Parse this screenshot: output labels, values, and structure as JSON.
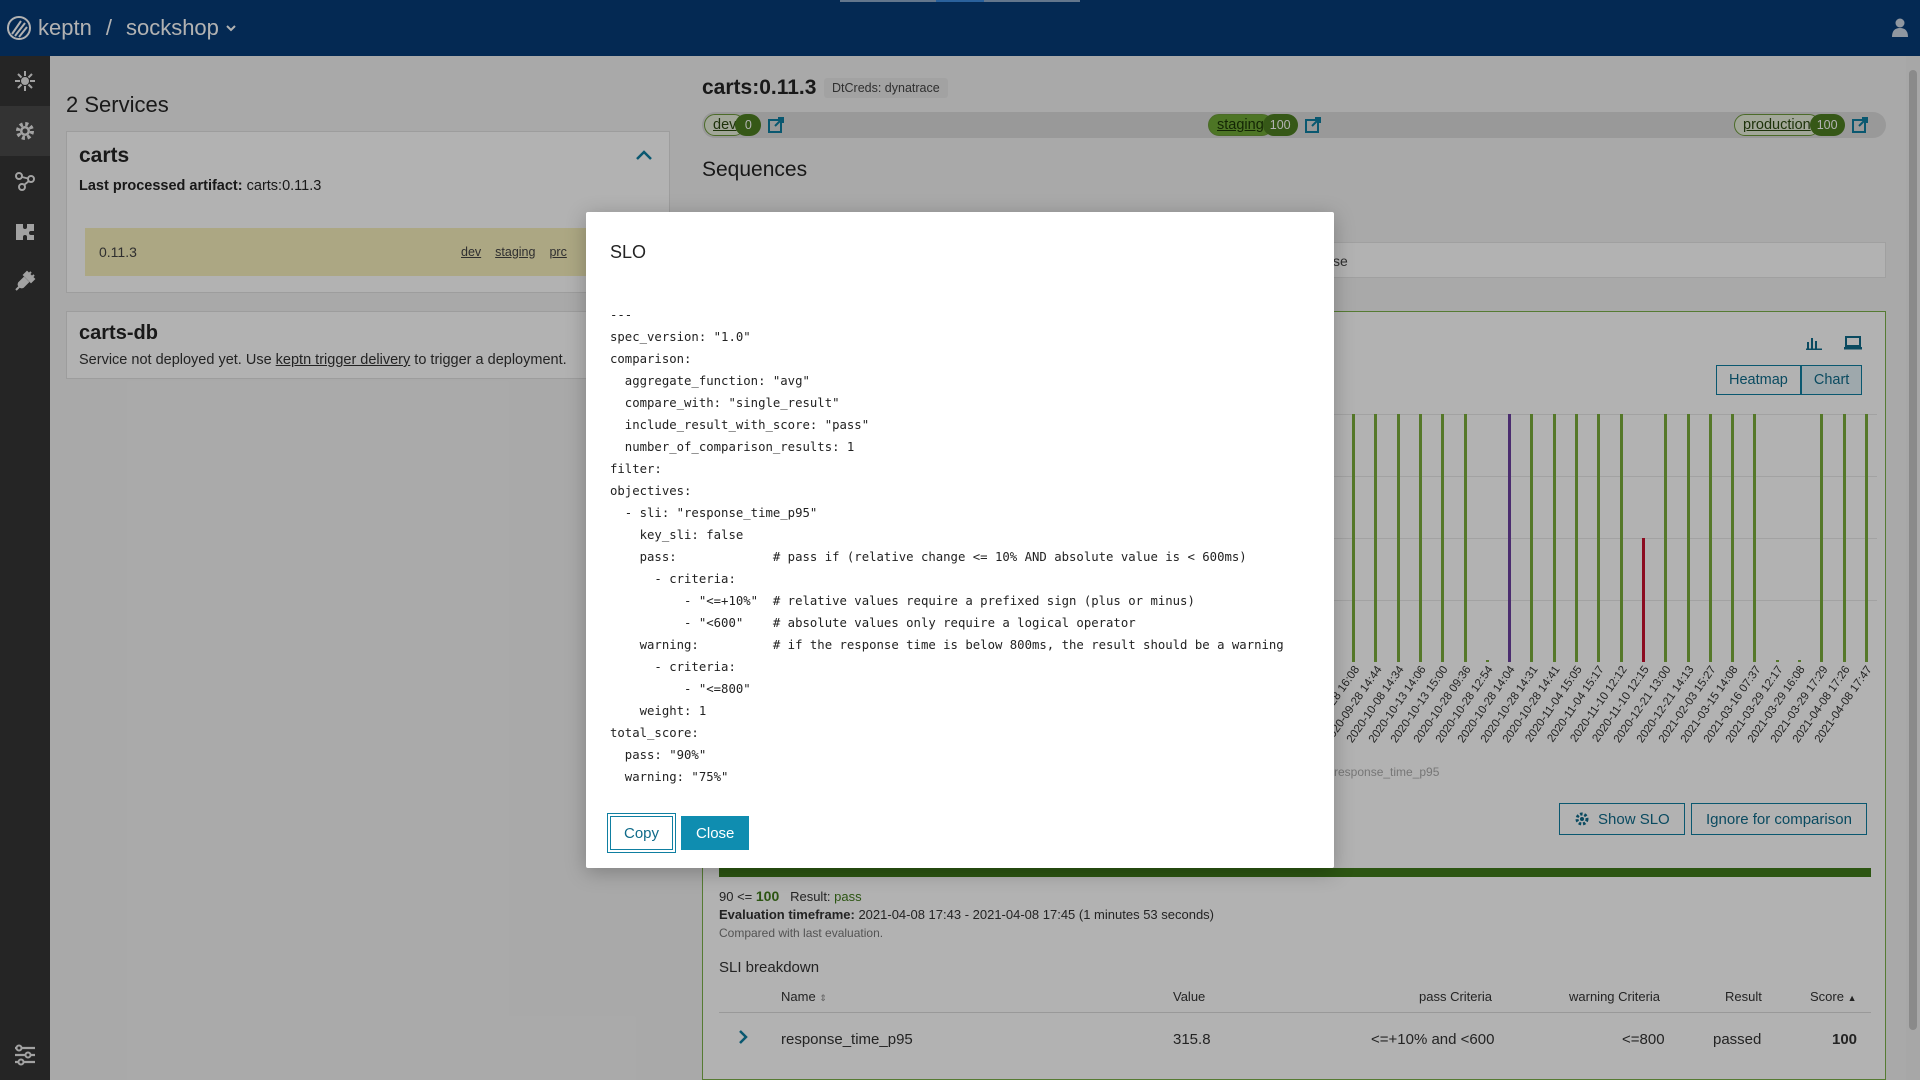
{
  "header": {
    "logo_text": "keptn",
    "separator": "/",
    "project": "sockshop"
  },
  "sidebar": {
    "items": [
      {
        "icon": "hub-icon"
      },
      {
        "icon": "gear-icon"
      },
      {
        "icon": "sequence-icon"
      },
      {
        "icon": "integrations-icon"
      },
      {
        "icon": "plug-icon"
      }
    ],
    "bottom_icon": "settings-sliders-icon"
  },
  "services": {
    "title": "2 Services",
    "carts": {
      "name": "carts",
      "artifact_label": "Last processed artifact:",
      "artifact_value": "carts:0.11.3",
      "row": {
        "version": "0.11.3",
        "stages": [
          "dev",
          "staging",
          "prc"
        ]
      }
    },
    "carts_db": {
      "name": "carts-db",
      "msg_before": "Service not deployed yet. Use ",
      "msg_link": "keptn trigger delivery",
      "msg_after": " to trigger a deployment."
    }
  },
  "detail": {
    "title": "carts:0.11.3",
    "creds": "DtCreds: dynatrace",
    "stages": [
      {
        "name": "dev",
        "count": "0"
      },
      {
        "name": "staging",
        "count": "100"
      },
      {
        "name": "production",
        "count": "100"
      }
    ],
    "sequences_title": "Sequences",
    "sequence_strip_text": "se",
    "toggle": {
      "heatmap": "Heatmap",
      "chart": "Chart"
    },
    "legend_faint": "response_time_p95",
    "show_slo": "Show SLO",
    "ignore": "Ignore for comparison",
    "score": {
      "range": "90 <= ",
      "value": "100",
      "result_label": "Result: ",
      "result": "pass"
    },
    "timeframe": {
      "label": "Evaluation timeframe:",
      "value": " 2021-04-08 17:43 - 2021-04-08 17:45 (1 minutes 53 seconds)"
    },
    "compared": "Compared with last evaluation.",
    "sli": {
      "title": "SLI breakdown",
      "headers": {
        "name": "Name",
        "value": "Value",
        "pass": "pass Criteria",
        "warning": "warning Criteria",
        "result": "Result",
        "score": "Score"
      },
      "row": {
        "name": "response_time_p95",
        "value": "315.8",
        "pass": "<=+10% and  <600",
        "warning": "<=800",
        "result": "passed",
        "score": "100"
      }
    }
  },
  "chart_data": {
    "type": "bar",
    "categories": [
      "..9-28 16:08",
      "2020-09-28 14:44",
      "2020-10-08 14:34",
      "2020-10-13 14:06",
      "2020-10-13 15:00",
      "2020-10-28 09:36",
      "2020-10-28 12:54",
      "2020-10-28 14:04",
      "2020-10-28 14:31",
      "2020-10-28 14:41",
      "2020-11-04 15:05",
      "2020-11-04 15:17",
      "2020-11-10 12:12",
      "2020-11-10 12:15",
      "2020-12-21 13:00",
      "2020-12-21 14:13",
      "2021-02-03 15:27",
      "2021-03-15 14:08",
      "2021-03-16 07:37",
      "2021-03-29 12:17",
      "2021-03-29 16:08",
      "2021-03-29 17:29",
      "2021-04-08 17:26",
      "2021-04-08 17:47"
    ],
    "values": [
      100,
      100,
      100,
      100,
      100,
      100,
      0,
      100,
      100,
      100,
      100,
      100,
      100,
      50,
      100,
      100,
      100,
      100,
      100,
      0,
      0,
      100,
      100,
      100
    ],
    "colors": [
      "#7aac3c",
      "#7aac3c",
      "#7aac3c",
      "#7aac3c",
      "#7aac3c",
      "#7aac3c",
      "#7aac3c",
      "#6b3fa0",
      "#7aac3c",
      "#7aac3c",
      "#7aac3c",
      "#7aac3c",
      "#7aac3c",
      "#c8102e",
      "#7aac3c",
      "#7aac3c",
      "#7aac3c",
      "#7aac3c",
      "#7aac3c",
      "#7aac3c",
      "#7aac3c",
      "#7aac3c",
      "#7aac3c",
      "#7aac3c"
    ],
    "ylim": [
      0,
      100
    ],
    "grid": true
  },
  "dialog": {
    "title": "SLO",
    "content": "---\nspec_version: \"1.0\"\ncomparison:\n  aggregate_function: \"avg\"\n  compare_with: \"single_result\"\n  include_result_with_score: \"pass\"\n  number_of_comparison_results: 1\nfilter:\nobjectives:\n  - sli: \"response_time_p95\"\n    key_sli: false\n    pass:             # pass if (relative change <= 10% AND absolute value is < 600ms)\n      - criteria:\n          - \"<=+10%\"  # relative values require a prefixed sign (plus or minus)\n          - \"<600\"    # absolute values only require a logical operator\n    warning:          # if the response time is below 800ms, the result should be a warning\n      - criteria:\n          - \"<=800\"\n    weight: 1\ntotal_score:\n  pass: \"90%\"\n  warning: \"75%\"",
    "copy": "Copy",
    "close": "Close"
  }
}
